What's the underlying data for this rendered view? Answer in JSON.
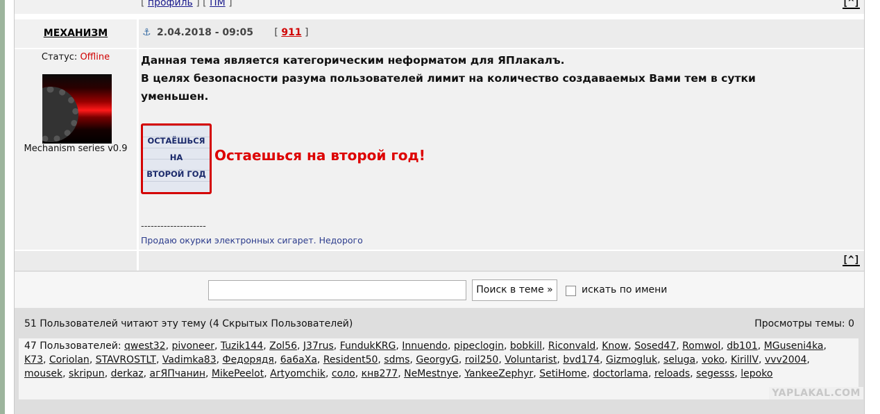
{
  "top_links": {
    "open1": "[ ",
    "profile": "профиль",
    "mid": " ] [ ",
    "pm": "ПМ",
    "close1": " ]"
  },
  "to_top": "[^]",
  "post": {
    "author": "МЕХАНИЗМ",
    "date": "2.04.2018 - 09:05",
    "rating_open": "[ ",
    "rating": "911",
    "rating_close": " ]",
    "status_label": "Статус: ",
    "status_value": "Offline",
    "user_title": "Mechanism series v0.9",
    "body_lines": [
      "Данная тема является категорическим неформатом для ЯПлакалъ.",
      "В целях безопасности разума пользователей лимит на количество создаваемых Вами тем в сутки",
      "уменьшен."
    ],
    "image_text": [
      "ОСТАЁШЬСЯ",
      "НА",
      "ВТОРОЙ ГОД"
    ],
    "image_caption": "Остаешься на второй год!",
    "sig_divider": "--------------------",
    "signature": "Продаю окурки электронных сигарет. Недорого"
  },
  "search": {
    "input_value": "",
    "button_label": "Поиск в теме »",
    "checkbox_label": "искать по имени",
    "checkbox_checked": false
  },
  "readers": {
    "summary": "51 Пользователей читают эту тему (4 Скрытых Пользователей)",
    "views": "Просмотры темы: 0",
    "users_prefix": "47 Пользователей: ",
    "users": [
      "qwest32",
      "pivoneer",
      "Tuzik144",
      "Zol56",
      "J37rus",
      "FundukKRG",
      "Innuendo",
      "pipeclogin",
      "bobkill",
      "Riconvald",
      "Know",
      "Sosed47",
      "Romwol",
      "db101",
      "MGuseni4ka",
      "K73",
      "Coriolan",
      "STAVROSTLT",
      "Vadimka83",
      "Федорядя",
      "6a6aXa",
      "Resident50",
      "sdms",
      "GeorgyG",
      "roil250",
      "Voluntarist",
      "bvd174",
      "Gizmogluk",
      "seluga",
      "voko",
      "KirillV",
      "vvv2004",
      "mousek",
      "skripun",
      "derkaz",
      "агЯПчанин",
      "MikePeelot",
      "Artyomchik",
      "соло",
      "кнв277",
      "NeMestnye",
      "YankeeZephyr",
      "SetiHome",
      "doctorlama",
      "reloads",
      "segesss",
      "lepoko"
    ]
  },
  "watermark": "YAPLAKAL.COM",
  "colors": {
    "accent_red": "#d00000",
    "link_blue": "#1a1a8c",
    "stripe": "#9db59d"
  },
  "icons": {
    "anchor": "⚓"
  }
}
